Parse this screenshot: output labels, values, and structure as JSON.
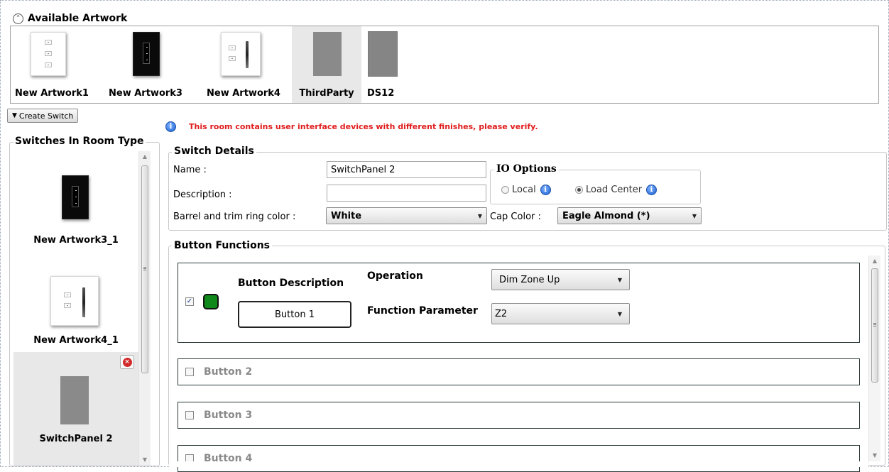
{
  "available_artwork": {
    "title": "Available Artwork",
    "items": [
      {
        "label": "New Artwork1"
      },
      {
        "label": "New Artwork3"
      },
      {
        "label": "New Artwork4"
      },
      {
        "label": "ThirdParty"
      },
      {
        "label": "DS12"
      }
    ]
  },
  "create_switch": {
    "label": "Create Switch"
  },
  "switches_in_room": {
    "title": "Switches In Room Type",
    "items": [
      {
        "label": "New Artwork3_1"
      },
      {
        "label": "New Artwork4_1"
      },
      {
        "label": "SwitchPanel 2"
      }
    ]
  },
  "warning": {
    "text": "This room contains user interface devices with different finishes, please verify."
  },
  "switch_details": {
    "title": "Switch Details",
    "name_label": "Name :",
    "name_value": "SwitchPanel 2",
    "description_label": "Description :",
    "description_value": "",
    "barrel_label": "Barrel and trim ring color :",
    "barrel_value": "White",
    "cap_label": "Cap Color :",
    "cap_value": "Eagle Almond (*)",
    "io_options": {
      "title": "IO Options",
      "local_label": "Local",
      "load_center_label": "Load Center",
      "selected": "Load Center"
    }
  },
  "button_functions": {
    "title": "Button Functions",
    "expanded": {
      "checked": true,
      "description_heading": "Button Description",
      "description_value": "Button 1",
      "operation_label": "Operation",
      "operation_value": "Dim Zone Up",
      "function_param_label": "Function Parameter",
      "function_param_value": "Z2",
      "led_color": "#0f8a1a"
    },
    "collapsed": [
      {
        "label": "Button 2",
        "checked": false
      },
      {
        "label": "Button 3",
        "checked": false
      },
      {
        "label": "Button 4",
        "checked": false
      }
    ]
  }
}
